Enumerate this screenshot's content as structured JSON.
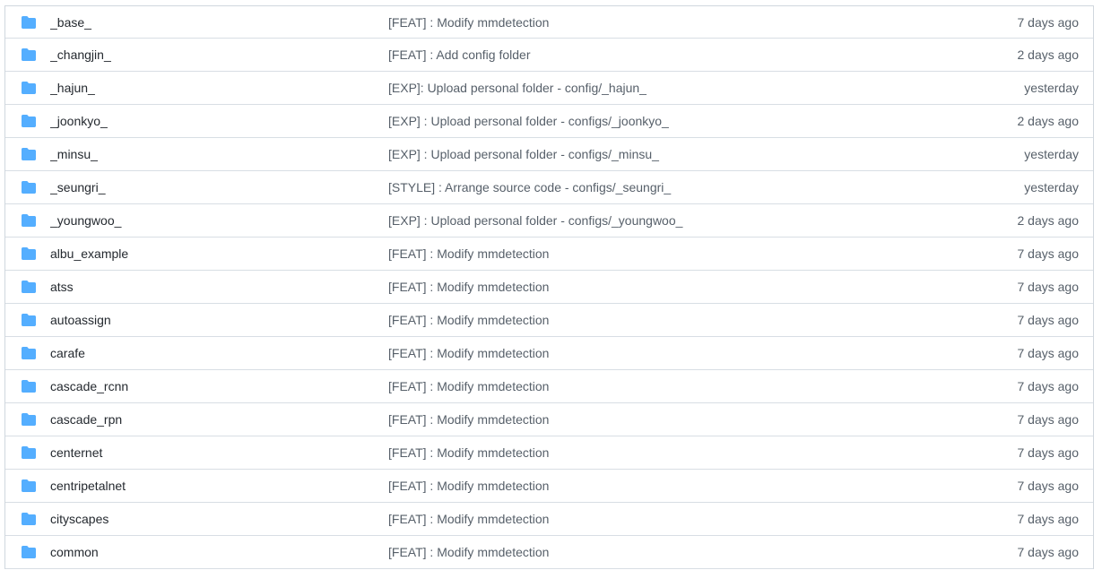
{
  "folder_icon": {
    "name": "folder-icon",
    "color": "#54aeff"
  },
  "rows": [
    {
      "name": "_base_",
      "message": "[FEAT] : Modify mmdetection",
      "age": "7 days ago"
    },
    {
      "name": "_changjin_",
      "message": "[FEAT] : Add config folder",
      "age": "2 days ago"
    },
    {
      "name": "_hajun_",
      "message": "[EXP]: Upload personal folder - config/_hajun_",
      "age": "yesterday"
    },
    {
      "name": "_joonkyo_",
      "message": "[EXP] : Upload personal folder - configs/_joonkyo_",
      "age": "2 days ago"
    },
    {
      "name": "_minsu_",
      "message": "[EXP] : Upload personal folder - configs/_minsu_",
      "age": "yesterday"
    },
    {
      "name": "_seungri_",
      "message": "[STYLE] : Arrange source code - configs/_seungri_",
      "age": "yesterday"
    },
    {
      "name": "_youngwoo_",
      "message": "[EXP] : Upload personal folder - configs/_youngwoo_",
      "age": "2 days ago"
    },
    {
      "name": "albu_example",
      "message": "[FEAT] : Modify mmdetection",
      "age": "7 days ago"
    },
    {
      "name": "atss",
      "message": "[FEAT] : Modify mmdetection",
      "age": "7 days ago"
    },
    {
      "name": "autoassign",
      "message": "[FEAT] : Modify mmdetection",
      "age": "7 days ago"
    },
    {
      "name": "carafe",
      "message": "[FEAT] : Modify mmdetection",
      "age": "7 days ago"
    },
    {
      "name": "cascade_rcnn",
      "message": "[FEAT] : Modify mmdetection",
      "age": "7 days ago"
    },
    {
      "name": "cascade_rpn",
      "message": "[FEAT] : Modify mmdetection",
      "age": "7 days ago"
    },
    {
      "name": "centernet",
      "message": "[FEAT] : Modify mmdetection",
      "age": "7 days ago"
    },
    {
      "name": "centripetalnet",
      "message": "[FEAT] : Modify mmdetection",
      "age": "7 days ago"
    },
    {
      "name": "cityscapes",
      "message": "[FEAT] : Modify mmdetection",
      "age": "7 days ago"
    },
    {
      "name": "common",
      "message": "[FEAT] : Modify mmdetection",
      "age": "7 days ago"
    }
  ]
}
